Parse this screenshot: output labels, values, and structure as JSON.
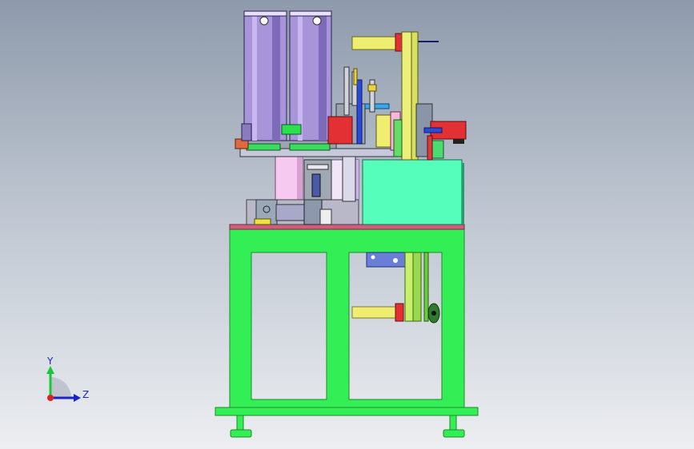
{
  "scene": {
    "title": "",
    "background_top": "#8e9aab",
    "background_bottom": "#eceef1"
  },
  "colors": {
    "frame": "#33ee55",
    "frame_edge": "#1c8a2a",
    "tabletop": "#d25c7e",
    "cylinder": "#a894d8",
    "cylinder_dark": "#7d6ab8",
    "block_green": "#55ffbb",
    "motor": "#f0ee70",
    "red_part": "#e23034",
    "lavender": "#c9b4e8",
    "pink_cyl": "#f5c9f0",
    "blue_part": "#3a5bd8"
  },
  "triad": {
    "y_label": "Y",
    "z_label": "Z",
    "icon": "coordinate-triad-icon"
  }
}
